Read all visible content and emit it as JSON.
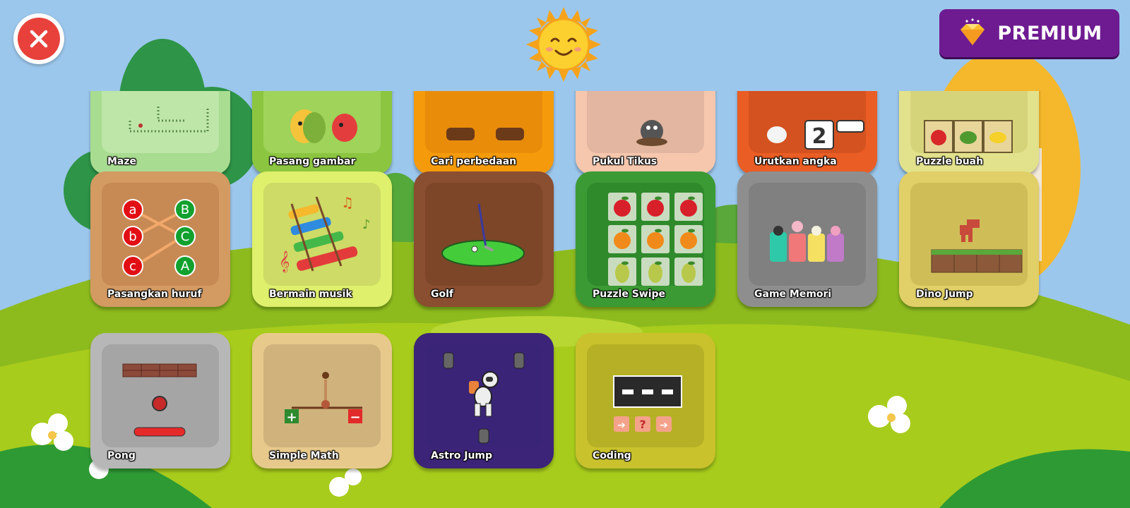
{
  "header": {
    "close_icon": "close-icon",
    "sun_icon": "smiling-sun",
    "premium": {
      "label": "PREMIUM",
      "icon": "diamond-icon",
      "color": "#6e1b91"
    }
  },
  "games": [
    {
      "label": "Maze",
      "color": "#a8dc90"
    },
    {
      "label": "Pasang gambar",
      "color": "#8cc640"
    },
    {
      "label": "Cari perbedaan",
      "color": "#f59b0b"
    },
    {
      "label": "Pukul Tikus",
      "color": "#f6c7ad"
    },
    {
      "label": "Urutkan angka",
      "color": "#ea5d24"
    },
    {
      "label": "Puzzle buah",
      "color": "#e3e28c"
    },
    {
      "label": "Pasangkan huruf",
      "color": "#d39a62"
    },
    {
      "label": "Bermain musik",
      "color": "#dff06c"
    },
    {
      "label": "Golf",
      "color": "#8a4e30"
    },
    {
      "label": "Puzzle Swipe",
      "color": "#3c9a34"
    },
    {
      "label": "Game Memori",
      "color": "#8e8e8e"
    },
    {
      "label": "Dino Jump",
      "color": "#e1cf67"
    },
    {
      "label": "Pong",
      "color": "#b7b7b7"
    },
    {
      "label": "Simple Math",
      "color": "#e8c98c"
    },
    {
      "label": "Astro Jump",
      "color": "#3c2479"
    },
    {
      "label": "Coding",
      "color": "#c9c22c"
    }
  ],
  "art": {
    "letters_left": [
      "a",
      "b",
      "c"
    ],
    "letters_right": [
      "B",
      "C",
      "A"
    ],
    "number_card": "2",
    "plus": "+",
    "minus": "−",
    "coding_question": "?"
  }
}
